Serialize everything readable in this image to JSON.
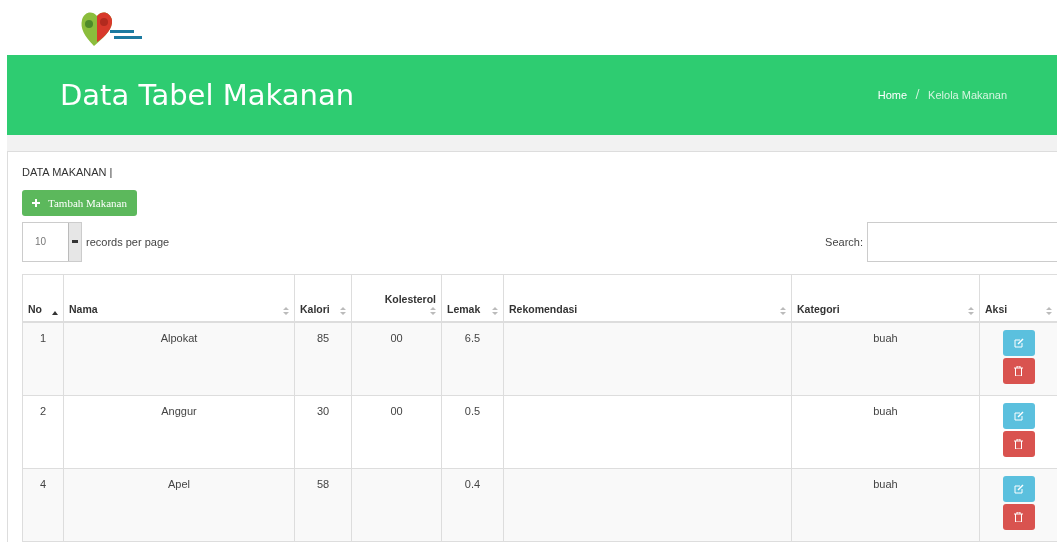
{
  "header": {
    "title": "Data Tabel Makanan",
    "breadcrumb": [
      {
        "label": "Home"
      },
      {
        "label": "Kelola Makanan"
      }
    ]
  },
  "section": {
    "title": "DATA MAKANAN |",
    "add_button": "Tambah Makanan"
  },
  "page_size": {
    "value": "10",
    "label": "records per page"
  },
  "search": {
    "label": "Search:"
  },
  "table": {
    "columns": [
      {
        "label": "No",
        "sorted": true
      },
      {
        "label": "Nama",
        "sorted": false
      },
      {
        "label": "Kalori",
        "sorted": false
      },
      {
        "label": "Kolesterol",
        "sorted": false
      },
      {
        "label": "Lemak",
        "sorted": false
      },
      {
        "label": "Rekomendasi",
        "sorted": false
      },
      {
        "label": "Kategori",
        "sorted": false
      },
      {
        "label": "Aksi",
        "sorted": false
      }
    ],
    "rows": [
      {
        "no": "1",
        "nama": "Alpokat",
        "kalori": "85",
        "kolesterol": "00",
        "lemak": "6.5",
        "kategori": "buah"
      },
      {
        "no": "2",
        "nama": "Anggur",
        "kalori": "30",
        "kolesterol": "00",
        "lemak": "0.5",
        "kategori": "buah"
      },
      {
        "no": "4",
        "nama": "Apel",
        "kalori": "58",
        "lemak": "0.4",
        "kategori": "buah"
      }
    ]
  }
}
